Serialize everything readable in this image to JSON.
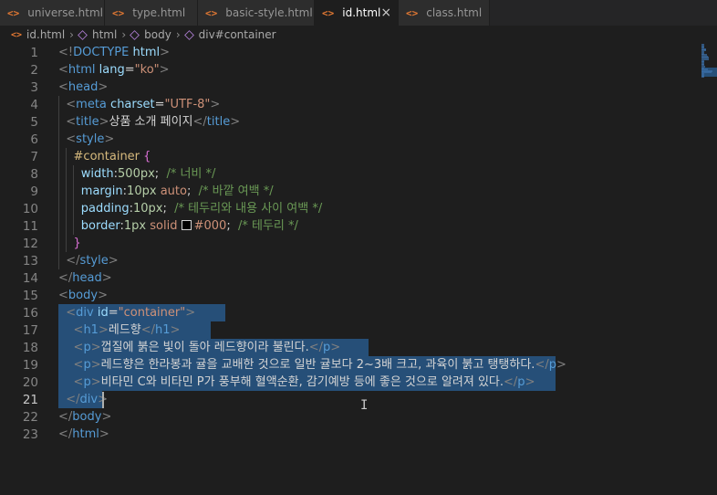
{
  "tabs": [
    {
      "label": "universe.html",
      "active": false
    },
    {
      "label": "type.html",
      "active": false
    },
    {
      "label": "basic-style.html",
      "active": false
    },
    {
      "label": "id.html",
      "active": true
    },
    {
      "label": "class.html",
      "active": false
    }
  ],
  "tab_icon_glyph": "<>",
  "tab_close_glyph": "×",
  "breadcrumb": [
    "id.html",
    "html",
    "body",
    "div#container"
  ],
  "breadcrumb_sep": "›",
  "lines": [
    "<!DOCTYPE html>",
    "<html lang=\"ko\">",
    "<head>",
    "  <meta charset=\"UTF-8\">",
    "  <title>상품 소개 페이지</title>",
    "  <style>",
    "    #container {",
    "      width:500px;  /* 너비 */",
    "      margin:10px auto;  /* 바깥 여백 */",
    "      padding:10px;  /* 테두리와 내용 사이 여백 */",
    "      border:1px solid #000;  /* 테두리 */",
    "    }",
    "  </style>",
    "</head>",
    "<body>",
    "  <div id=\"container\">",
    "    <h1>레드향</h1>",
    "    <p>껍질에 붉은 빛이 돌아 레드향이라 불린다.</p>",
    "    <p>레드향은 한라봉과 귤을 교배한 것으로 일반 귤보다 2~3배 크고, 과육이 붉고 탱탱하다.</p>",
    "    <p>비타민 C와 비타민 P가 풍부해 혈액순환, 감기예방 등에 좋은 것으로 알려져 있다.</p>",
    "  </div>",
    "</body>",
    "</html>"
  ],
  "current_line": 21,
  "colors": {
    "background": "#1e1e1e",
    "selection": "#264f78",
    "tag": "#569cd6",
    "attribute": "#9cdcfe",
    "string": "#ce9178",
    "comment": "#6a9955",
    "number": "#b5cea8",
    "selector": "#d7ba7d"
  }
}
